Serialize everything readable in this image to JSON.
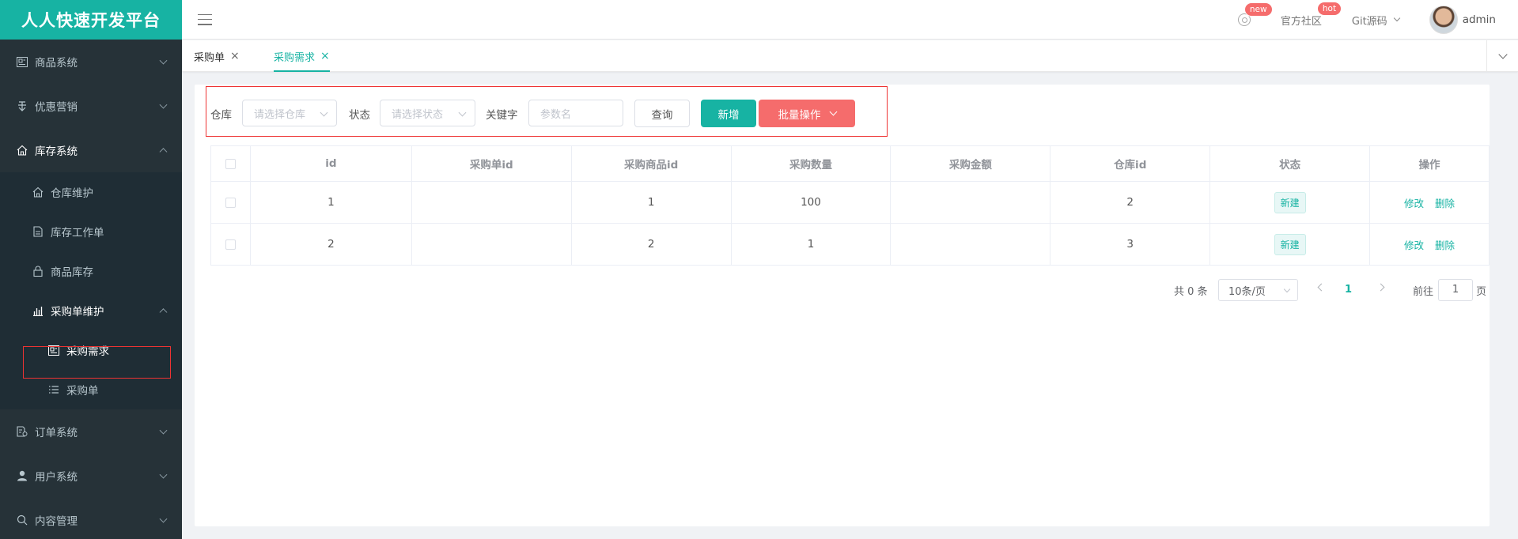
{
  "brand": "人人快速开发平台",
  "header": {
    "settings_badge": "new",
    "community_label": "官方社区",
    "community_badge": "hot",
    "git_label": "Git源码",
    "username": "admin"
  },
  "sidebar": {
    "items": [
      {
        "label": "商品系统"
      },
      {
        "label": "优惠营销"
      },
      {
        "label": "库存系统"
      },
      {
        "label": "订单系统"
      },
      {
        "label": "用户系统"
      },
      {
        "label": "内容管理"
      }
    ],
    "inventory_sub": [
      {
        "label": "仓库维护"
      },
      {
        "label": "库存工作单"
      },
      {
        "label": "商品库存"
      },
      {
        "label": "采购单维护"
      }
    ],
    "purchase_sub": [
      {
        "label": "采购需求"
      },
      {
        "label": "采购单"
      }
    ]
  },
  "tabs": [
    {
      "label": "采购单",
      "close": "×"
    },
    {
      "label": "采购需求",
      "close": "×"
    }
  ],
  "filter": {
    "warehouse_label": "仓库",
    "warehouse_placeholder": "请选择仓库",
    "status_label": "状态",
    "status_placeholder": "请选择状态",
    "keyword_label": "关键字",
    "keyword_placeholder": "参数名",
    "query_btn": "查询",
    "add_btn": "新增",
    "batch_btn": "批量操作"
  },
  "table": {
    "columns": [
      "id",
      "采购单id",
      "采购商品id",
      "采购数量",
      "采购金额",
      "仓库id",
      "状态",
      "操作"
    ],
    "rows": [
      {
        "id": "1",
        "purchase_id": "",
        "sku_id": "1",
        "qty": "100",
        "amount": "",
        "ware_id": "2",
        "status": "新建"
      },
      {
        "id": "2",
        "purchase_id": "",
        "sku_id": "2",
        "qty": "1",
        "amount": "",
        "ware_id": "3",
        "status": "新建"
      }
    ],
    "edit_label": "修改",
    "delete_label": "删除"
  },
  "pagination": {
    "total_text": "共 0 条",
    "page_size": "10条/页",
    "current_page": "1",
    "goto_label": "前往",
    "goto_value": "1",
    "page_unit": "页"
  },
  "colors": {
    "brand": "#17b3a3",
    "sidebar_bg": "#263238",
    "danger": "#f56c6c"
  }
}
